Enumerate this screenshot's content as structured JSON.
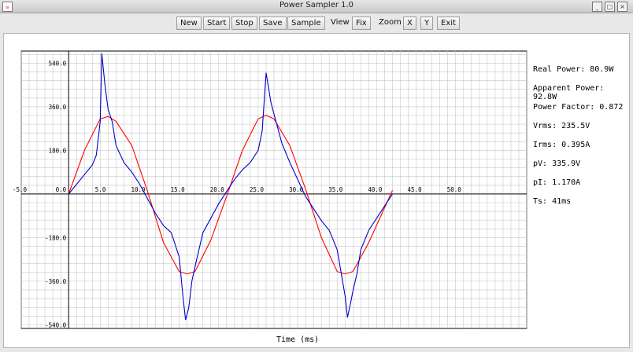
{
  "window": {
    "title": "Power Sampler 1.0",
    "minimize": "_",
    "maximize": "□",
    "close": "×"
  },
  "toolbar": {
    "new": "New",
    "start": "Start",
    "stop": "Stop",
    "save": "Save",
    "sample": "Sample",
    "view_label": "View",
    "fix": "Fix",
    "zoom_label": "Zoom",
    "zoom_x": "X",
    "zoom_y": "Y",
    "exit": "Exit"
  },
  "readouts": {
    "real_power": "Real Power: 80.9W",
    "apparent_power": "Apparent Power: 92.8W",
    "power_factor": "Power Factor: 0.872",
    "vrms": "Vrms: 235.5V",
    "irms": "Irms: 0.395A",
    "pv": "pV: 335.9V",
    "pi": "pI: 1.170A",
    "ts": "Ts: 41ms"
  },
  "chart_data": {
    "type": "line",
    "xlabel": "Time (ms)",
    "ylabel": "",
    "xlim": [
      -6,
      58
    ],
    "ylim": [
      -555,
      590
    ],
    "x_ticks": [
      "-5.0",
      "0.0",
      "5.0",
      "10.0",
      "15.0",
      "20.0",
      "25.0",
      "30.0",
      "35.0",
      "40.0",
      "45.0",
      "50.0"
    ],
    "x_tick_values": [
      -5,
      0,
      5,
      10,
      15,
      20,
      25,
      30,
      35,
      40,
      45,
      50
    ],
    "y_ticks": [
      "540.0",
      "360.0",
      "180.0",
      "-180.0",
      "-360.0",
      "-540.0"
    ],
    "y_tick_values": [
      540,
      360,
      180,
      -180,
      -360,
      -540
    ],
    "grid": true,
    "colors": {
      "voltage": "#ff0000",
      "current": "#0000cc",
      "grid": "#c8c8c8",
      "axis": "#000000"
    },
    "series": [
      {
        "key": "voltage",
        "x": [
          0,
          2,
          4,
          5,
          6,
          8,
          10,
          12,
          14,
          15,
          16,
          18,
          20,
          22,
          24,
          25,
          26,
          28,
          30,
          32,
          34,
          35,
          36,
          38,
          41
        ],
        "values": [
          0,
          180,
          310,
          320,
          300,
          200,
          10,
          -200,
          -320,
          -330,
          -320,
          -190,
          -10,
          180,
          310,
          325,
          310,
          200,
          20,
          -180,
          -320,
          -330,
          -320,
          -200,
          15
        ]
      },
      {
        "key": "current",
        "x": [
          0,
          1,
          2,
          3,
          3.5,
          4,
          4.2,
          4.6,
          5,
          5.5,
          6,
          7,
          8,
          9,
          10,
          11,
          12,
          13,
          14,
          14.5,
          14.8,
          15.2,
          15.6,
          16,
          17,
          18,
          19,
          20,
          21,
          22,
          23,
          24,
          24.5,
          25,
          25.2,
          25.6,
          26,
          27,
          28,
          29,
          30,
          31,
          32,
          33,
          34,
          35,
          35.3,
          35.7,
          36,
          36.5,
          37,
          38,
          39,
          40,
          41
        ],
        "values": [
          0,
          40,
          80,
          120,
          160,
          300,
          580,
          450,
          350,
          300,
          200,
          130,
          90,
          40,
          -20,
          -80,
          -130,
          -160,
          -260,
          -430,
          -520,
          -470,
          -360,
          -300,
          -160,
          -100,
          -40,
          10,
          60,
          100,
          130,
          180,
          260,
          500,
          460,
          380,
          330,
          210,
          130,
          60,
          -10,
          -60,
          -110,
          -150,
          -230,
          -420,
          -510,
          -450,
          -400,
          -330,
          -230,
          -150,
          -100,
          -50,
          0
        ]
      }
    ]
  }
}
